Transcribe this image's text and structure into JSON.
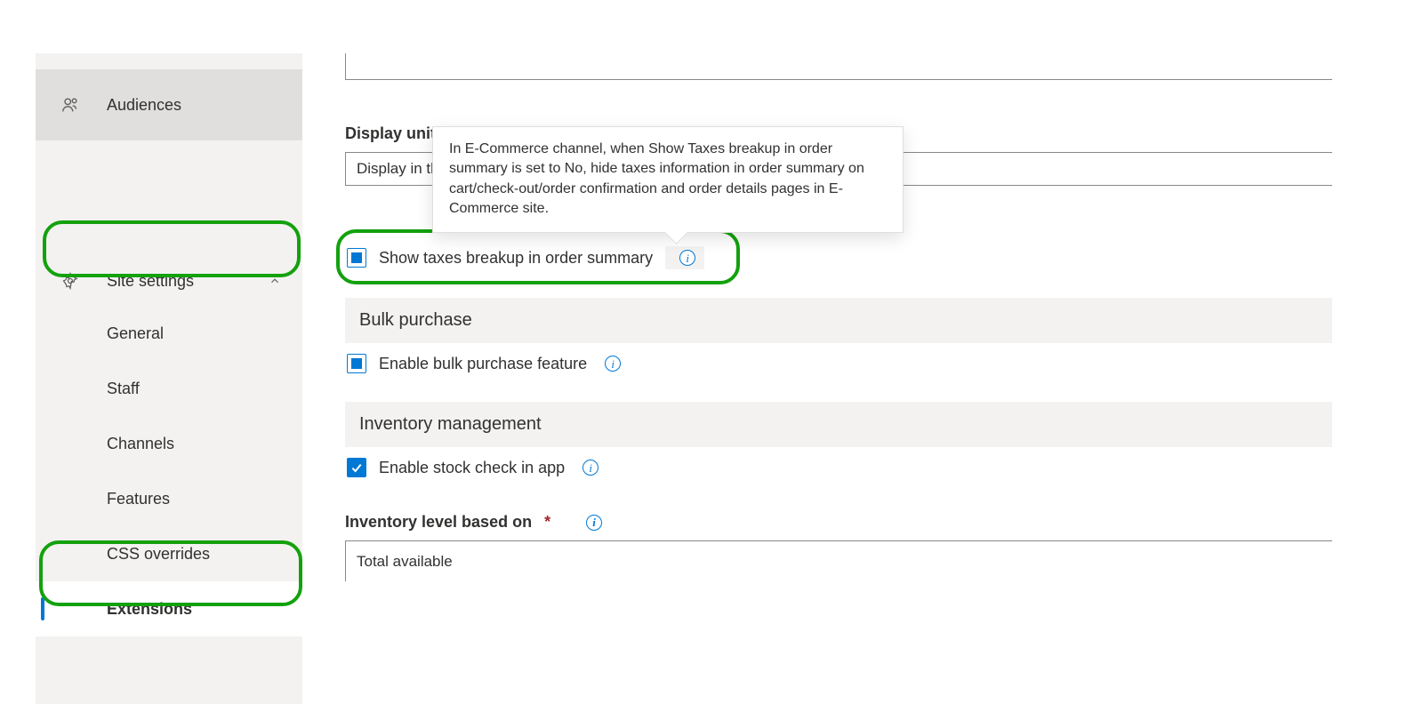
{
  "sidebar": {
    "audiences_label": "Audiences",
    "site_settings_label": "Site settings",
    "items": {
      "general": "General",
      "staff": "Staff",
      "channels": "Channels",
      "features": "Features",
      "css_overrides": "CSS overrides",
      "extensions": "Extensions"
    }
  },
  "main": {
    "display_unit_label": "Display unit of r",
    "display_unit_value": "Display in the ",
    "tooltip_text": "In E-Commerce channel, when Show Taxes breakup in order summary is set to No, hide taxes information in order summary on cart/check-out/order confirmation and order details pages in E-Commerce site.",
    "show_taxes_label": "Show taxes breakup in order summary",
    "bulk_purchase_header": "Bulk purchase",
    "enable_bulk_label": "Enable bulk purchase feature",
    "inventory_header": "Inventory management",
    "enable_stock_label": "Enable stock check in app",
    "inventory_level_label": "Inventory level based on",
    "inventory_level_value": "Total available"
  }
}
